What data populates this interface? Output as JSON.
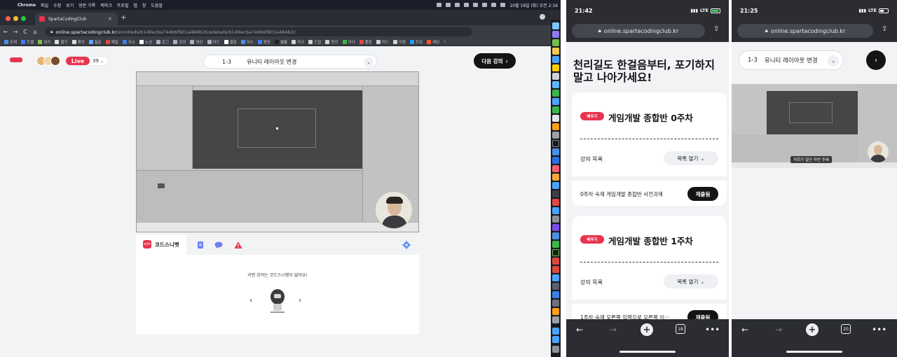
{
  "menubar": {
    "app": "Chrome",
    "menus": [
      "파일",
      "수정",
      "보기",
      "방문 기록",
      "북마크",
      "프로필",
      "탭",
      "창",
      "도움말"
    ],
    "clock": "10월 19일 (화) 오전 2:16"
  },
  "browser": {
    "tab_title": "SpartaCodingClub",
    "url_host": "online.spartacodingclub.kr",
    "url_path": "/enrolleds/6149ecba744b6f901a484b26/edetails/6149ecba744b6f901a484b2c",
    "bookmarks": [
      "두레",
      "트렐",
      "위키",
      "캘기",
      "제이",
      "질문",
      "메일",
      "주소",
      "노션",
      "로그",
      "강의",
      "영상",
      "어드",
      "결함",
      "어스",
      "편상",
      "별룸",
      "라크",
      "드립",
      "펀지",
      "리다",
      "플립",
      "어드",
      "이영",
      "트위",
      "레딩"
    ],
    "bookmarks_more": "»"
  },
  "lecture": {
    "live_label": "Live",
    "viewer_count": "39",
    "selector_number": "1-3",
    "selector_title": "유니티 레이아웃 변경",
    "next_button": "다음 강의"
  },
  "snippet": {
    "tab_label": "코드스니펫",
    "empty_message": "이번 강의는 코드스니펫이 없어요!"
  },
  "phone1": {
    "time": "21:42",
    "network": "LTE",
    "url": "online.spartacodingclub.kr",
    "headline": "천리길도 한걸음부터, 포기하지 말고 나아가세요!",
    "weeks": [
      {
        "tag": "배우기",
        "title": "게임개발 종합반 0주차",
        "list_label": "강의 목록",
        "open_label": "목록 열기",
        "homework": "0주차 숙제 게임개발 종합반 사전과제",
        "status": "제출됨"
      },
      {
        "tag": "배우기",
        "title": "게임개발 종합반 1주차",
        "list_label": "강의 목록",
        "open_label": "목록 열기",
        "homework": "1주차 숙제 오른쪽 입력으로 오른쪽 이···",
        "status": "제출됨"
      }
    ],
    "tab_count": "18"
  },
  "phone2": {
    "time": "21:25",
    "network": "LTE",
    "url": "online.spartacodingclub.kr",
    "selector_number": "1-3",
    "selector_title": "유니티 레이아웃 변경",
    "subtitle": "저희가 일단 저번 주에",
    "tab_count": "20"
  },
  "colors": {
    "brand": "#e8344e",
    "dark": "#141414",
    "chrome": "#2b2d33"
  }
}
